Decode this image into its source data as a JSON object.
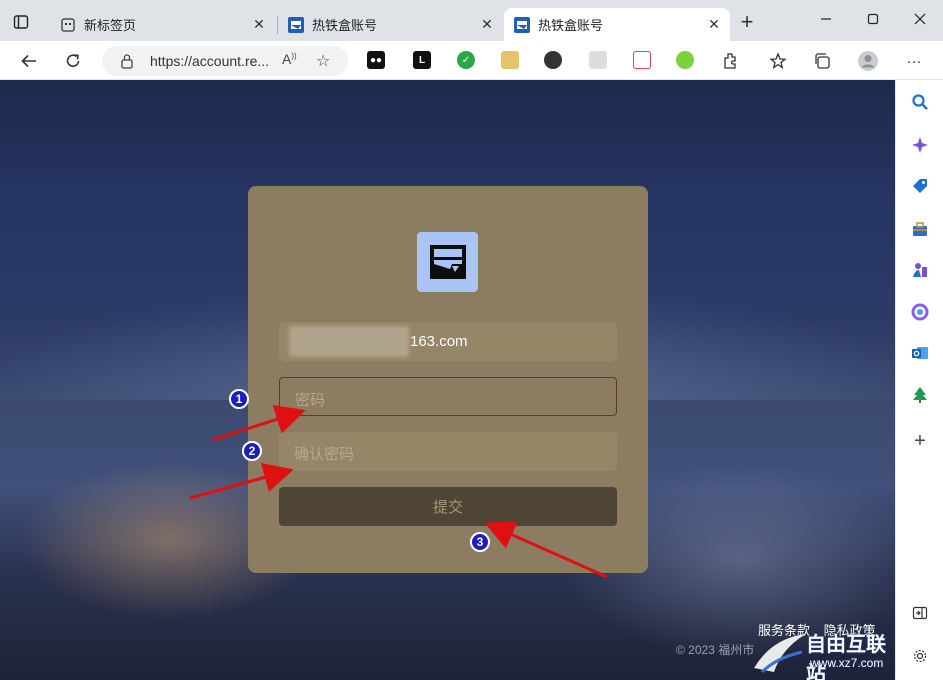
{
  "tabs": [
    {
      "label": "新标签页"
    },
    {
      "label": "热铁盒账号"
    },
    {
      "label": "热铁盒账号"
    }
  ],
  "addressbar": {
    "url": "https://account.re..."
  },
  "form": {
    "email_value": "163.com",
    "password_placeholder": "密码",
    "confirm_placeholder": "确认密码",
    "submit_label": "提交"
  },
  "footer": {
    "terms": "服务条款",
    "privacy": "隐私政策",
    "copyright": "© 2023 福州市"
  },
  "annotations": [
    "1",
    "2",
    "3"
  ],
  "watermark": {
    "title": "自由互联站",
    "url": "www.xz7.com"
  },
  "colors": {
    "card": "#8b7c62",
    "submit": "#4e4536",
    "annotation_badge": "#1d1dc8",
    "arrow": "#e01010",
    "logo_bg": "#a9c4f5"
  }
}
